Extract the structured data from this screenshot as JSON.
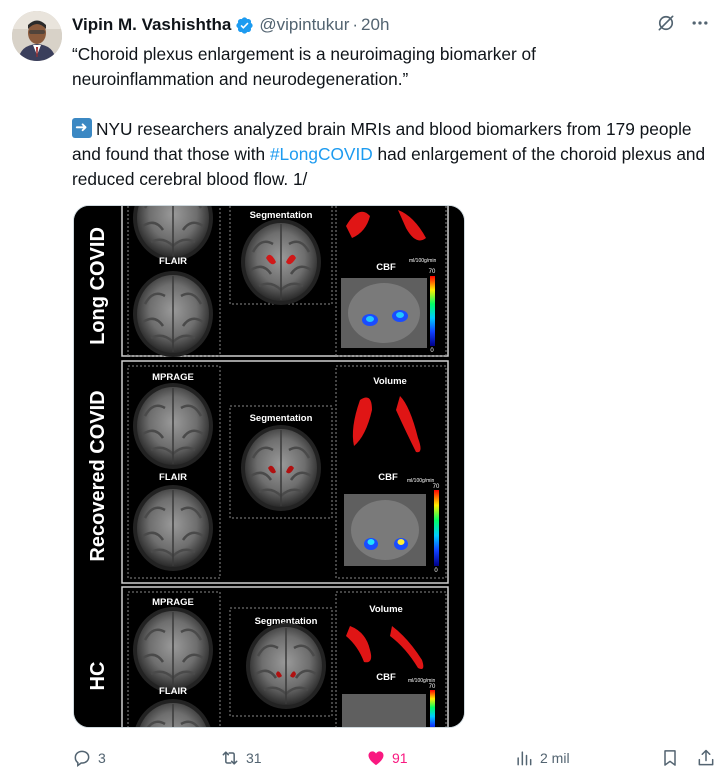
{
  "author": {
    "name": "Vipin M. Vashishtha",
    "handle": "@vipintukur",
    "separator": "·",
    "time": "20h"
  },
  "tweet": {
    "quote_line1": "“Choroid plexus enlargement is a neuroimaging biomarker of",
    "quote_line2": "neuroinflammation and neurodegeneration.”",
    "body_pre": "NYU researchers analyzed brain MRIs and blood biomarkers from 179 people and found that those with",
    "hashtag": "#LongCOVID",
    "body_post": "had enlargement of the choroid plexus and reduced cerebral blood flow.  1/"
  },
  "figure": {
    "row_labels": [
      "Long COVID",
      "Recovered COVID",
      "HC"
    ],
    "mprage": "MPRAGE",
    "flair": "FLAIR",
    "segmentation": "Segmentation",
    "volume": "Volume",
    "cbf": "CBF",
    "cbf_unit": "ml/100g/min",
    "scale_max": "70",
    "scale_min": "0"
  },
  "actions": {
    "replies": "3",
    "reposts": "31",
    "likes": "91",
    "views": "2 mil"
  },
  "colors": {
    "accent": "#1d9bf0",
    "like": "#f91880",
    "muted": "#536471"
  }
}
